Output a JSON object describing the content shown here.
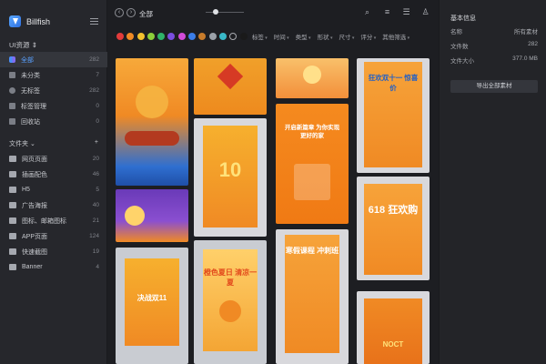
{
  "app": {
    "name": "Billfish"
  },
  "library": {
    "label": "UI资源 ⇕"
  },
  "nav": [
    {
      "label": "全部",
      "count": "282"
    },
    {
      "label": "未分类",
      "count": "7"
    },
    {
      "label": "无标签",
      "count": "282"
    },
    {
      "label": "标签管理",
      "count": "0"
    },
    {
      "label": "回收站",
      "count": "0"
    }
  ],
  "folders_header": {
    "label": "文件夹 ⌄",
    "add": "+"
  },
  "folders": [
    {
      "label": "网页页面",
      "count": "20"
    },
    {
      "label": "插画配色",
      "count": "46"
    },
    {
      "label": "H5",
      "count": "5"
    },
    {
      "label": "广告海报",
      "count": "40"
    },
    {
      "label": "图标、邮箱图标",
      "count": "21"
    },
    {
      "label": "APP页面",
      "count": "124"
    },
    {
      "label": "快速截图",
      "count": "19"
    },
    {
      "label": "Banner",
      "count": "4"
    }
  ],
  "toolbar": {
    "breadcrumb": "全部"
  },
  "colors": [
    "#e23b3b",
    "#f08a24",
    "#f2c12e",
    "#8ccf3a",
    "#2fb36a",
    "#7a4ee0",
    "#d24bd8",
    "#3b7de8",
    "#c77b2a",
    "#9aa0a8",
    "#39b8c8",
    "#e8e8e8",
    "#1a1a1a"
  ],
  "filters": [
    "标签",
    "时间",
    "类型",
    "形状",
    "尺寸",
    "评分",
    "其他筛选"
  ],
  "info": {
    "title": "基本信息",
    "rows": [
      {
        "k": "名称",
        "v": "所有素材"
      },
      {
        "k": "文件数",
        "v": "282"
      },
      {
        "k": "文件大小",
        "v": "377.0 MB"
      }
    ],
    "export_button": "导出全部素材"
  },
  "posters": [
    {
      "text": ""
    },
    {
      "text": ""
    },
    {
      "text": ""
    },
    {
      "text": "狂欢双十一 惊喜价"
    },
    {
      "text": "开启新篇章 为你实现更好的家"
    },
    {
      "text": "10"
    },
    {
      "text": ""
    },
    {
      "text": "618 狂欢购"
    },
    {
      "text": ""
    },
    {
      "text": "决战双11"
    },
    {
      "text": "橙色夏日 清凉一夏"
    },
    {
      "text": "寒假课程 冲刺班"
    },
    {
      "text": "NOCT"
    }
  ]
}
